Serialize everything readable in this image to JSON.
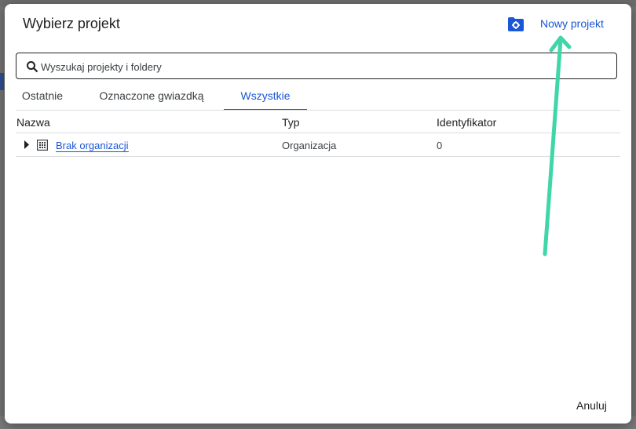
{
  "dialog": {
    "title": "Wybierz projekt",
    "new_project_label": "Nowy projekt",
    "cancel_label": "Anuluj",
    "search": {
      "placeholder": "Wyszukaj projekty i foldery",
      "value": ""
    },
    "tabs": [
      {
        "label": "Ostatnie",
        "active": false
      },
      {
        "label": "Oznaczone gwiazdką",
        "active": false
      },
      {
        "label": "Wszystkie",
        "active": true
      }
    ],
    "table": {
      "columns": [
        "Nazwa",
        "Typ",
        "Identyfikator"
      ],
      "rows": [
        {
          "name": "Brak organizacji",
          "type": "Organizacja",
          "id": "0"
        }
      ]
    },
    "icons": {
      "folder_settings": "folder-settings-icon",
      "search": "search-icon",
      "expand": "caret-right-icon",
      "organization": "building-icon"
    }
  },
  "colors": {
    "accent": "#1a56d6",
    "annotation_arrow": "#3fd6a8",
    "overlay": "#727272"
  }
}
